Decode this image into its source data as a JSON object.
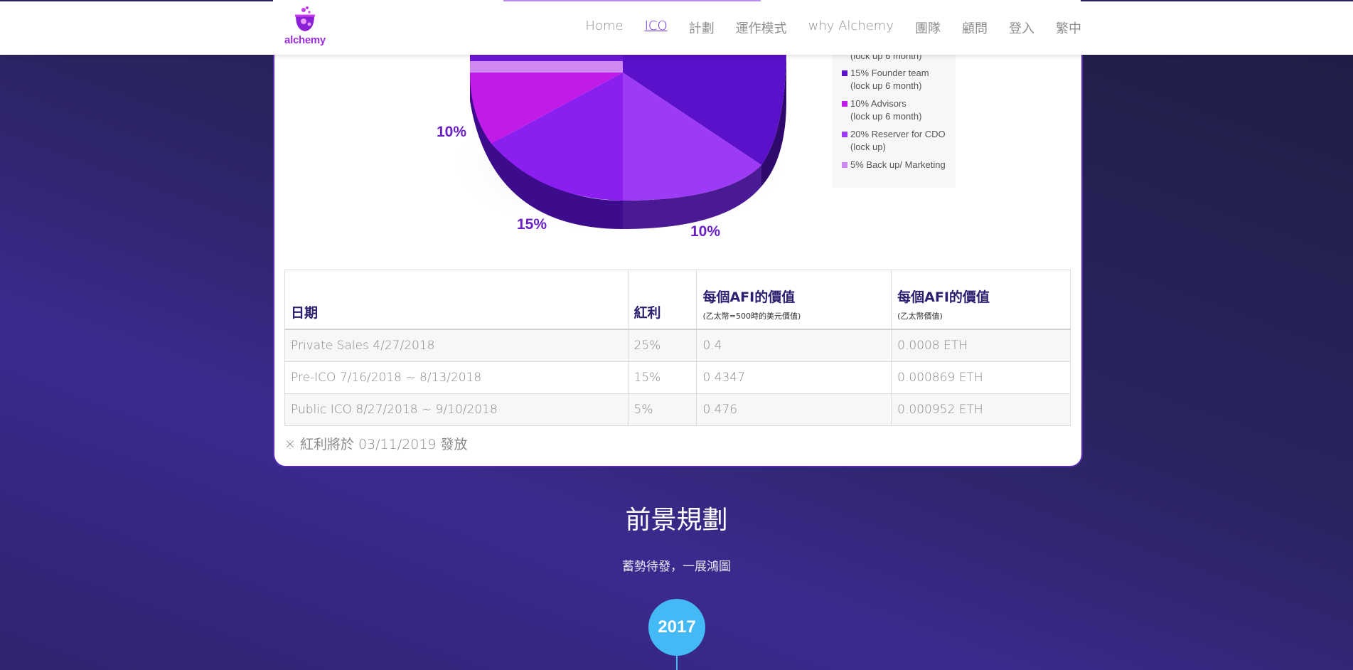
{
  "brand": {
    "logo_text": "alchemy"
  },
  "nav": [
    {
      "label": "Home",
      "active": false
    },
    {
      "label": "ICO",
      "active": true
    },
    {
      "label": "計劃",
      "active": false
    },
    {
      "label": "運作模式",
      "active": false
    },
    {
      "label": "why Alchemy",
      "active": false
    },
    {
      "label": "團隊",
      "active": false
    },
    {
      "label": "顧問",
      "active": false
    },
    {
      "label": "登入",
      "active": false
    },
    {
      "label": "繁中",
      "active": false
    }
  ],
  "pie": {
    "labels": [
      "10%",
      "15%",
      "10%"
    ],
    "colors": {
      "founder": "#5b10c9",
      "advisors": "#c11be8",
      "reserve": "#9d3af5",
      "backup": "#d089f2"
    }
  },
  "legend": [
    {
      "text": "(lock up 6 month)",
      "color": ""
    },
    {
      "text": "15% Founder team\n(lock up 6 month)",
      "color": "#5b10c9"
    },
    {
      "text": "10% Advisors\n(lock up 6 month)",
      "color": "#c11be8"
    },
    {
      "text": "20% Reserver for CDO\n(lock up)",
      "color": "#9d3af5"
    },
    {
      "text": "5% Back up/ Marketing",
      "color": "#d089f2"
    }
  ],
  "table": {
    "headers": [
      {
        "title": "日期",
        "sub": ""
      },
      {
        "title": "紅利",
        "sub": ""
      },
      {
        "title": "每個AFI的價值",
        "sub": "(乙太幣=500時的美元價值)"
      },
      {
        "title": "每個AFI的價值",
        "sub": "(乙太幣價值)"
      }
    ],
    "rows": [
      [
        "Private Sales 4/27/2018",
        "25%",
        "0.4",
        "0.0008 ETH"
      ],
      [
        "Pre-ICO 7/16/2018 ~ 8/13/2018",
        "15%",
        "0.4347",
        "0.000869 ETH"
      ],
      [
        "Public ICO 8/27/2018 ~ 9/10/2018",
        "5%",
        "0.476",
        "0.000952 ETH"
      ]
    ]
  },
  "note": "※ 紅利將於 03/11/2019 發放",
  "roadmap": {
    "title": "前景規劃",
    "subtitle": "蓄勢待發，一展鴻圖",
    "year": "2017"
  }
}
